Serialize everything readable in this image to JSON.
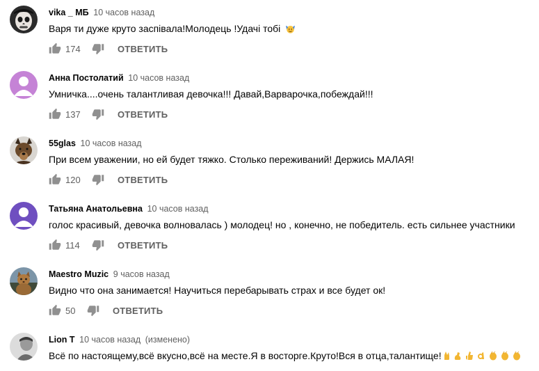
{
  "comments": [
    {
      "author": "vika _ МБ",
      "time": "10 часов назад",
      "edited": "",
      "text": "Варя ти дуже круто заспівала!Молодець !Удачі тобі",
      "emoji": "🙆",
      "likes": "174",
      "reply_label": "ОТВЕТИТЬ",
      "avatar": "skull-avatar"
    },
    {
      "author": "Анна Постолатий",
      "time": "10 часов назад",
      "edited": "",
      "text": "Умничка....очень талантливая девочка!!! Давай,Варварочка,побеждай!!!",
      "likes": "137",
      "reply_label": "ОТВЕТИТЬ",
      "avatar": "default-avatar",
      "avatar_color": "#c583d6"
    },
    {
      "author": "55glas",
      "time": "10 часов назад",
      "edited": "",
      "text": "При всем уважении, но ей будет тяжко. Столько переживаний! Держись МАЛАЯ!",
      "likes": "120",
      "reply_label": "ОТВЕТИТЬ",
      "avatar": "dog-avatar"
    },
    {
      "author": "Татьяна Анатольевна",
      "time": "10 часов назад",
      "edited": "",
      "text": "голос красивый,  девочка волновалась ) молодец!  но , конечно, не победитель.  есть сильнее участники",
      "likes": "114",
      "reply_label": "ОТВЕТИТЬ",
      "avatar": "default-avatar",
      "avatar_color": "#6f4fc0"
    },
    {
      "author": "Maestro Muzic",
      "time": "9 часов назад",
      "edited": "",
      "text": "Видно что она занимается! Научиться перебарывать страх и все будет ок!",
      "likes": "50",
      "reply_label": "ОТВЕТИТЬ",
      "avatar": "cat-avatar"
    },
    {
      "author": "Lion T",
      "time": "10 часов назад",
      "edited": "(изменено)",
      "text": "Всё по настоящему,всё вкусно,всё на месте.Я в восторге.Круто!Вся в отца,талантище!",
      "emoji": "🤞💪👍👌👏👏👏",
      "likes": "",
      "reply_label": "",
      "avatar": "photo-avatar"
    }
  ],
  "icons": {
    "like": "thumb-up-icon",
    "dislike": "thumb-down-icon"
  },
  "colors": {
    "text": "#030303",
    "secondary": "#606060",
    "icon": "#909090"
  }
}
